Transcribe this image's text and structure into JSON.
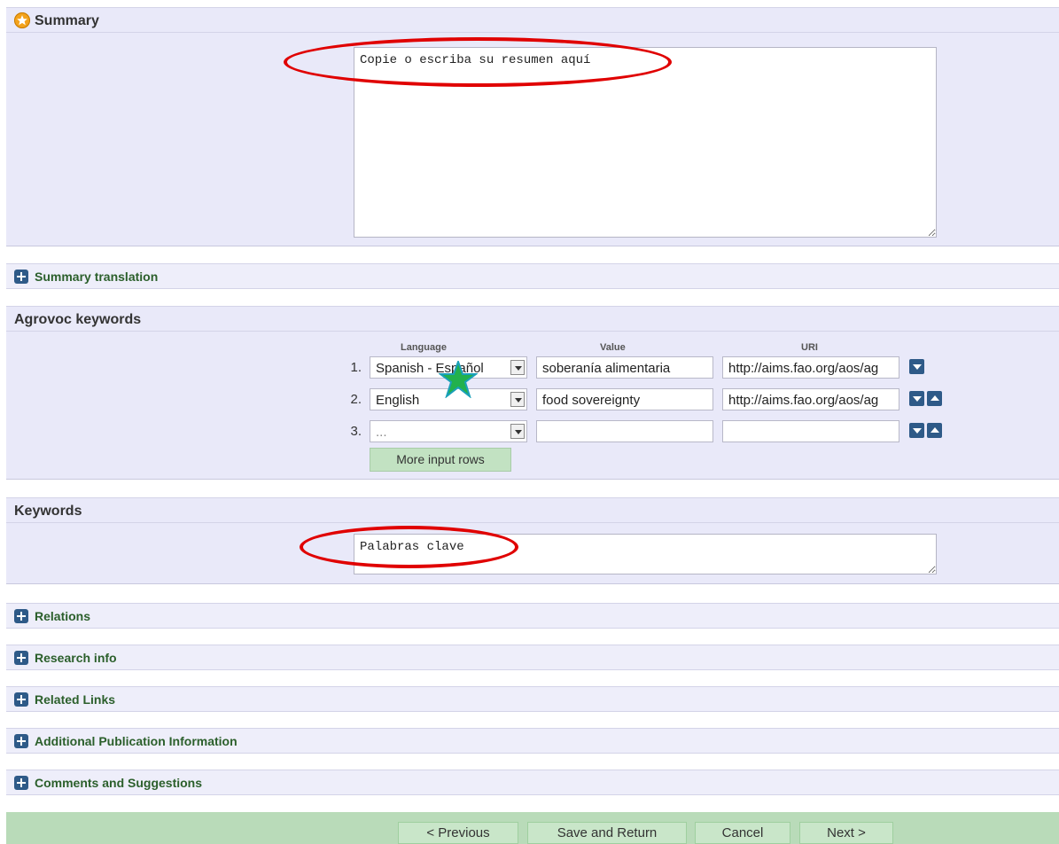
{
  "summary": {
    "title": "Summary",
    "text": "Copie o escriba su resumen aquí"
  },
  "summary_translation": {
    "title": "Summary translation"
  },
  "agrovoc": {
    "title": "Agrovoc keywords",
    "headers": {
      "language": "Language",
      "value": "Value",
      "uri": "URI"
    },
    "rows": [
      {
        "num": "1.",
        "language": "Spanish - Español",
        "value": "soberanía alimentaria",
        "uri": "http://aims.fao.org/aos/ag"
      },
      {
        "num": "2.",
        "language": "English",
        "value": "food sovereignty",
        "uri": "http://aims.fao.org/aos/ag"
      },
      {
        "num": "3.",
        "language": "...",
        "value": "",
        "uri": ""
      }
    ],
    "more_rows_label": "More input rows"
  },
  "keywords": {
    "title": "Keywords",
    "text": "Palabras clave"
  },
  "sections": [
    {
      "title": "Relations"
    },
    {
      "title": "Research info"
    },
    {
      "title": "Related Links"
    },
    {
      "title": "Additional Publication Information"
    },
    {
      "title": "Comments and Suggestions"
    }
  ],
  "footer": {
    "previous": "< Previous",
    "save": "Save and Return",
    "cancel": "Cancel",
    "next": "Next >"
  },
  "annotations": {
    "ellipse_color": "#e00000",
    "star_colors": [
      "#1aa0b8",
      "#22b14c"
    ]
  }
}
